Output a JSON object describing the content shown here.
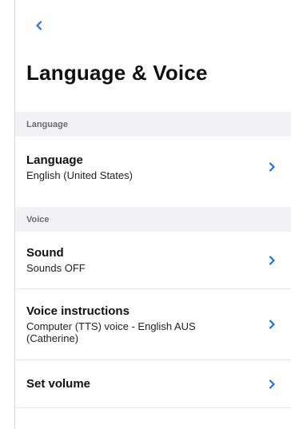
{
  "nav": {
    "back_icon": "chevron-left-icon"
  },
  "page": {
    "title": "Language & Voice"
  },
  "colors": {
    "accent": "#1a73e8",
    "section_bg": "#f2f2f4",
    "divider": "#e3e3e6"
  },
  "sections": [
    {
      "header": "Language",
      "items": [
        {
          "label": "Language",
          "value": "English (United States)",
          "icon": "chevron-right-icon"
        }
      ]
    },
    {
      "header": "Voice",
      "items": [
        {
          "label": "Sound",
          "value": "Sounds OFF",
          "icon": "chevron-right-icon"
        },
        {
          "label": "Voice instructions",
          "value": "Computer (TTS) voice - English AUS (Catherine)",
          "icon": "chevron-right-icon"
        },
        {
          "label": "Set volume",
          "value": "",
          "icon": "chevron-right-icon"
        }
      ]
    }
  ]
}
